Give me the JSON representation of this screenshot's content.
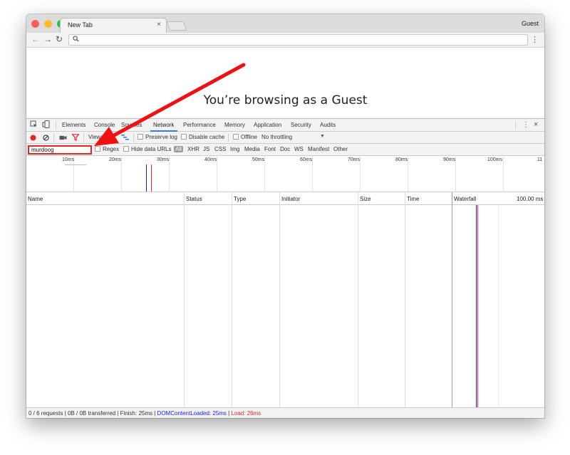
{
  "browser": {
    "tab_title": "New Tab",
    "tab_close": "×",
    "profile_label": "Guest",
    "page_heading": "You’re browsing as a Guest"
  },
  "icons": {
    "back": "back-arrow-icon",
    "forward": "forward-arrow-icon",
    "reload": "reload-icon",
    "search": "search-icon",
    "menu": "vertical-dots-icon"
  },
  "devtools": {
    "tabs": [
      "Elements",
      "Console",
      "Sources",
      "Network",
      "Performance",
      "Memory",
      "Application",
      "Security",
      "Audits"
    ],
    "active_tab": "Network",
    "close": "×",
    "controls": {
      "view_label": "View:",
      "preserve_log": "Preserve log",
      "disable_cache": "Disable cache",
      "offline": "Offline",
      "throttling": "No throttling"
    },
    "filter": {
      "value": "murdoog",
      "regex": "Regex",
      "hide_data_urls": "Hide data URLs",
      "types": [
        "All",
        "XHR",
        "JS",
        "CSS",
        "Img",
        "Media",
        "Font",
        "Doc",
        "WS",
        "Manifest",
        "Other"
      ]
    },
    "overview_ticks": [
      "10ms",
      "20ms",
      "30ms",
      "40ms",
      "50ms",
      "60ms",
      "70ms",
      "80ms",
      "90ms",
      "100ms",
      "11"
    ],
    "columns": [
      "Name",
      "Status",
      "Type",
      "Initiator",
      "Size",
      "Time",
      "Waterfall"
    ],
    "waterfall_scale": "100.00 ms",
    "status": {
      "summary": "0 / 6 requests | 0B / 0B transferred | Finish: 25ms | ",
      "dom_content_loaded": "DOMContentLoaded: 25ms",
      "separator": " | ",
      "load": "Load: 26ms"
    }
  },
  "colors": {
    "record": "#e62626",
    "accent": "#3879d9",
    "dom_content_loaded": "#1a1aff",
    "load": "#e62626",
    "annotation": "#ee1111"
  }
}
